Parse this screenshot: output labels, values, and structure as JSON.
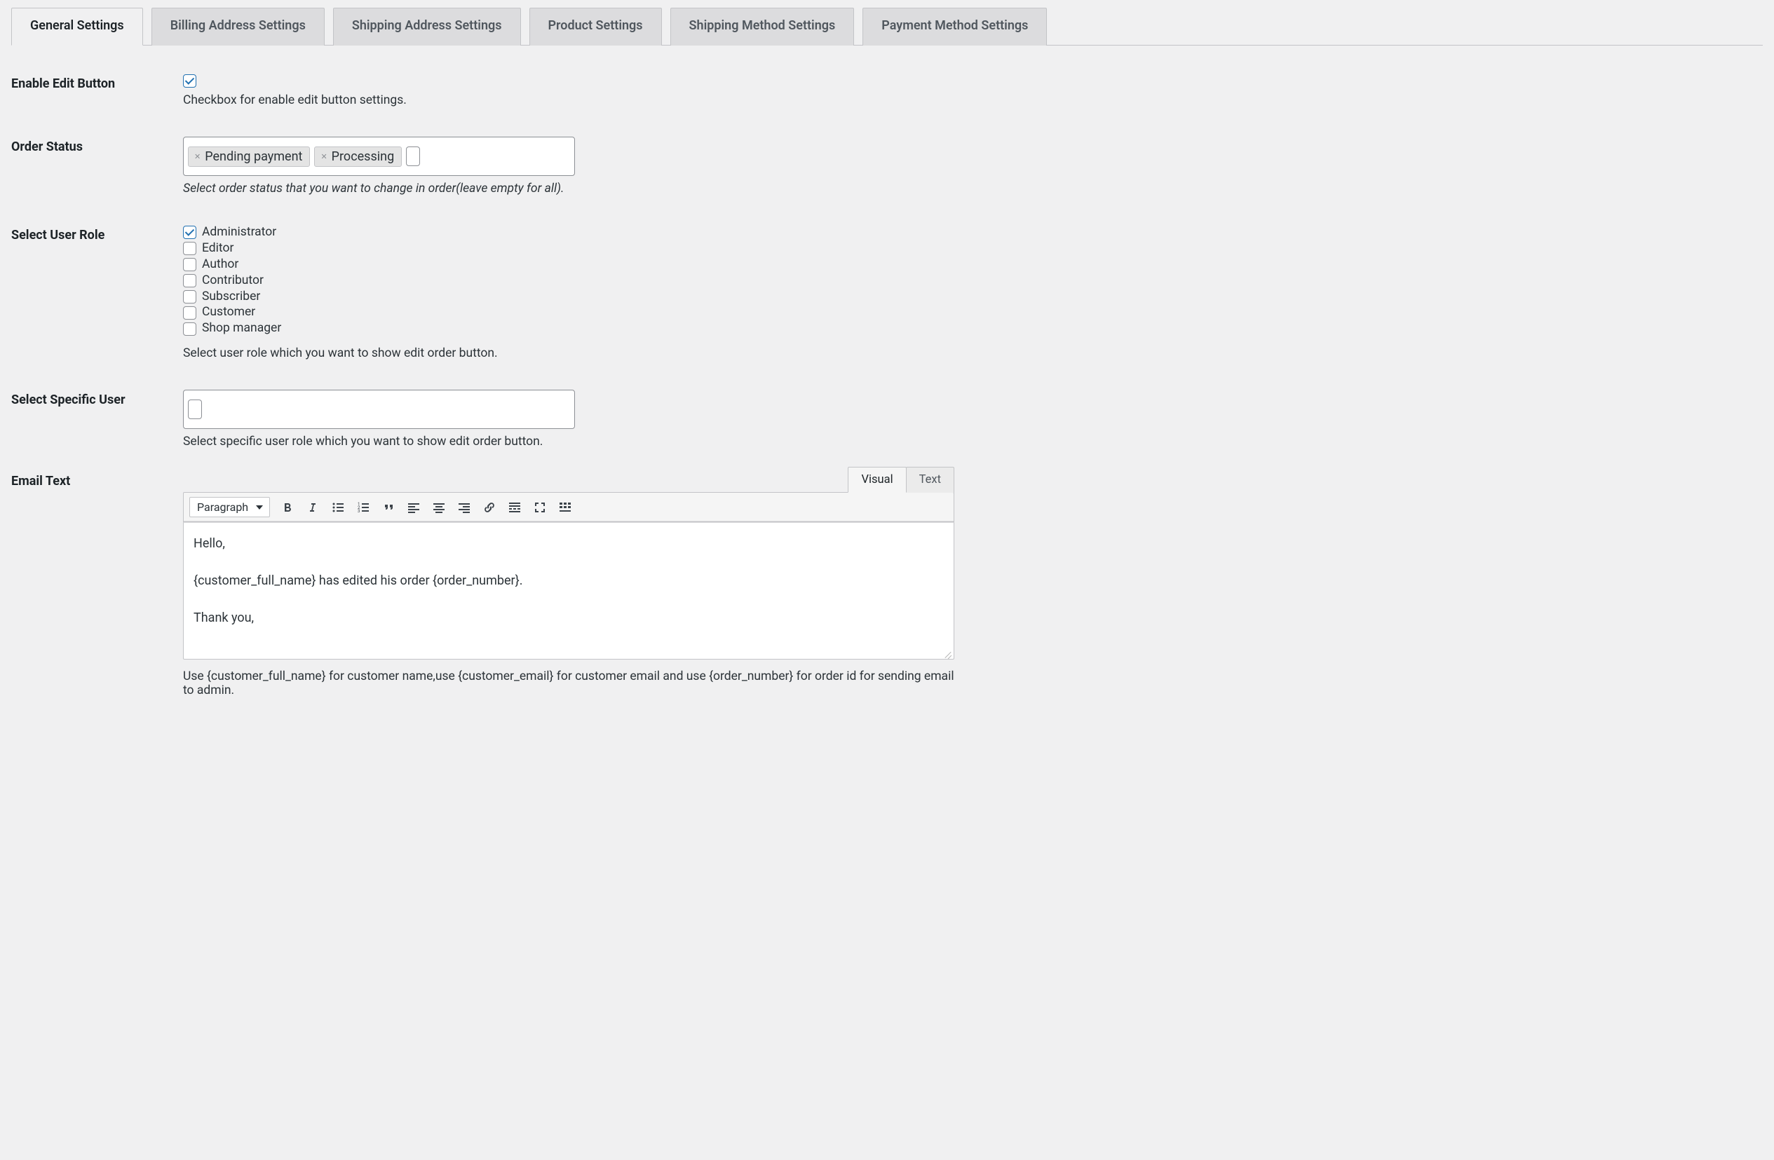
{
  "tabs": [
    {
      "id": "general",
      "label": "General Settings",
      "active": true
    },
    {
      "id": "billing",
      "label": "Billing Address Settings",
      "active": false
    },
    {
      "id": "shipping",
      "label": "Shipping Address Settings",
      "active": false
    },
    {
      "id": "product",
      "label": "Product Settings",
      "active": false
    },
    {
      "id": "shipmethod",
      "label": "Shipping Method Settings",
      "active": false
    },
    {
      "id": "paymethod",
      "label": "Payment Method Settings",
      "active": false
    }
  ],
  "fields": {
    "enable_edit": {
      "label": "Enable Edit Button",
      "checked": true,
      "desc": "Checkbox for enable edit button settings."
    },
    "order_status": {
      "label": "Order Status",
      "tags": [
        "Pending payment",
        "Processing"
      ],
      "desc": "Select order status that you want to change in order(leave empty for all)."
    },
    "user_role": {
      "label": "Select User Role",
      "options": [
        {
          "label": "Administrator",
          "checked": true
        },
        {
          "label": "Editor",
          "checked": false
        },
        {
          "label": "Author",
          "checked": false
        },
        {
          "label": "Contributor",
          "checked": false
        },
        {
          "label": "Subscriber",
          "checked": false
        },
        {
          "label": "Customer",
          "checked": false
        },
        {
          "label": "Shop manager",
          "checked": false
        }
      ],
      "desc": "Select user role which you want to show edit order button."
    },
    "specific_user": {
      "label": "Select Specific User",
      "tags": [],
      "desc": "Select specific user role which you want to show edit order button."
    },
    "email_text": {
      "label": "Email Text",
      "editor_tabs": {
        "visual": "Visual",
        "text": "Text",
        "active": "visual"
      },
      "format_select": "Paragraph",
      "content": [
        "Hello,",
        "{customer_full_name} has edited his order {order_number}.",
        "Thank you,"
      ],
      "desc": "Use {customer_full_name} for customer name,use {customer_email} for customer email and use {order_number} for order id for sending email to admin."
    }
  },
  "toolbar_icons": [
    "bold",
    "italic",
    "bullet-list",
    "number-list",
    "blockquote",
    "align-left",
    "align-center",
    "align-right",
    "link",
    "read-more",
    "fullscreen",
    "toolbar-toggle"
  ]
}
